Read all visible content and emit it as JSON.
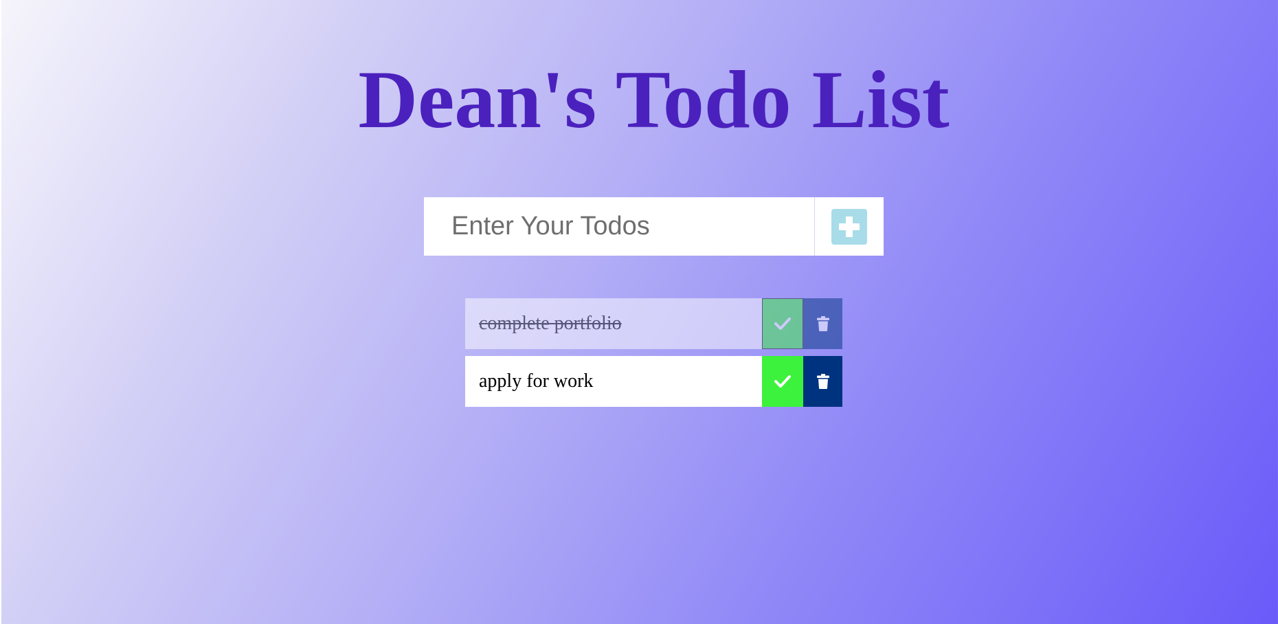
{
  "page": {
    "title": "Dean's Todo List"
  },
  "form": {
    "input_placeholder": "Enter Your Todos",
    "input_value": "",
    "add_icon": "plus-icon"
  },
  "todos": [
    {
      "text": "complete portfolio",
      "completed": true,
      "complete_icon": "check-icon",
      "delete_icon": "trash-icon"
    },
    {
      "text": "apply for work",
      "completed": false,
      "complete_icon": "check-icon",
      "delete_icon": "trash-icon"
    }
  ],
  "colors": {
    "title": "#4b21bd",
    "add_button": "#a8dce8",
    "complete_button": "#3cf23c",
    "delete_button": "#00337f",
    "gradient_start": "#f6f5fb",
    "gradient_end": "#6a5af9"
  }
}
